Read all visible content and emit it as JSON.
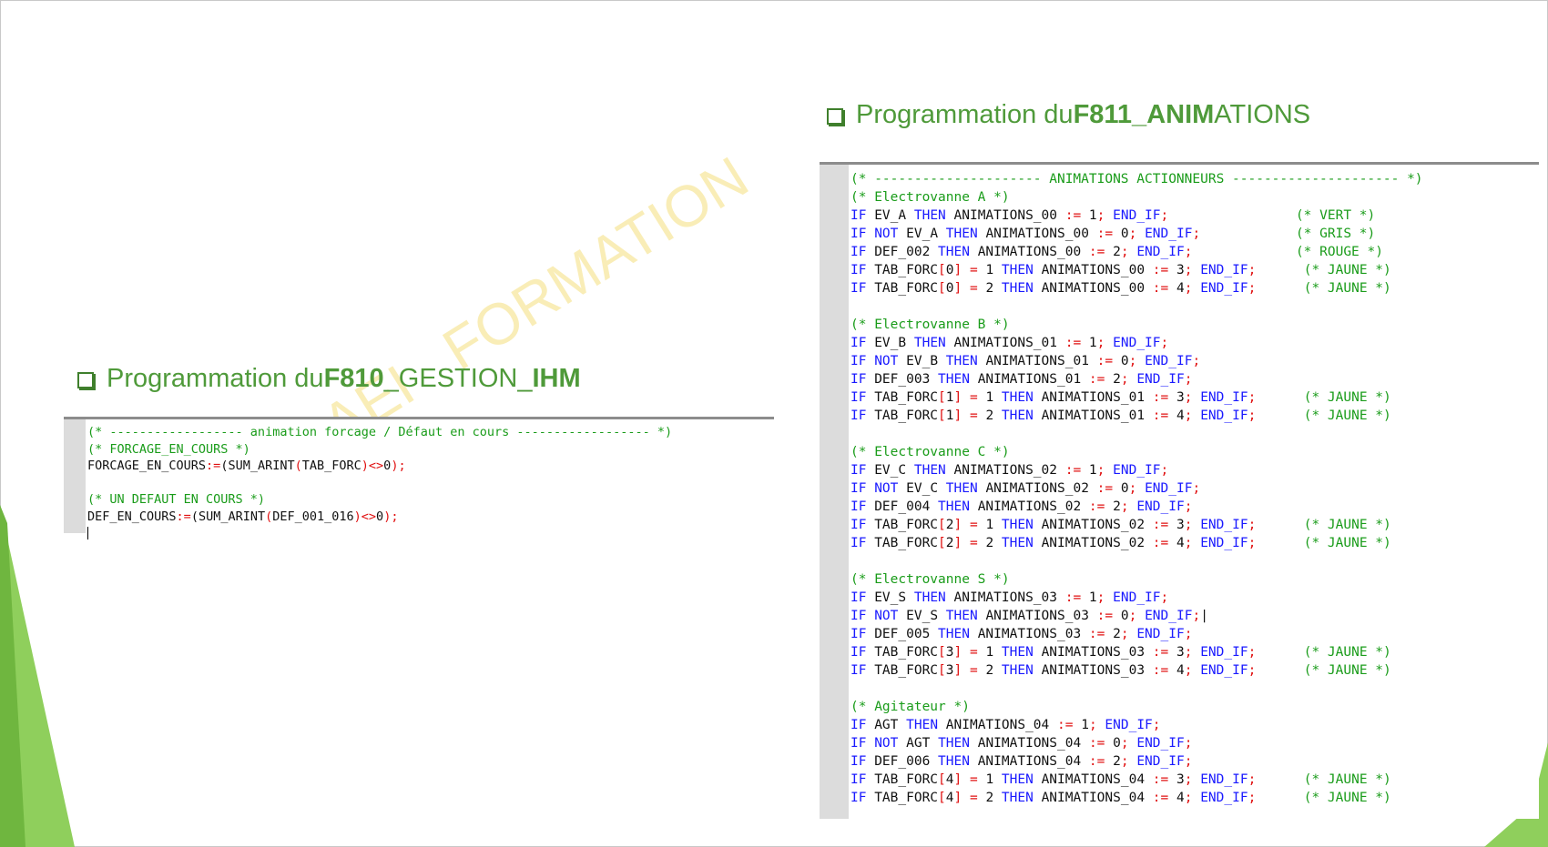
{
  "watermark": "AEI   FORMATION",
  "heading_left": {
    "prefix": "Programmation du ",
    "bold1": "F810",
    "middle": "_GESTION_",
    "bold2": "IHM",
    "suffix": ""
  },
  "heading_right": {
    "prefix": "Programmation du ",
    "bold1": "F811_ANIM",
    "middle": "ATIONS",
    "bold2": "",
    "suffix": ""
  },
  "code_left": [
    [
      {
        "t": "(* ------------------ animation forcage / Défaut en cours ------------------ *)",
        "c": "cm"
      }
    ],
    [
      {
        "t": "(* FORCAGE_EN_COURS *)",
        "c": "cm"
      }
    ],
    [
      {
        "t": "FORCAGE_EN_COURS"
      },
      {
        "t": ":=",
        "c": "op"
      },
      {
        "t": "(SUM_ARINT"
      },
      {
        "t": "(",
        "c": "op"
      },
      {
        "t": "TAB_FORC"
      },
      {
        "t": ")",
        "c": "op"
      },
      {
        "t": "<>",
        "c": "op"
      },
      {
        "t": "0"
      },
      {
        "t": ");",
        "c": "op"
      }
    ],
    [
      {
        "t": ""
      }
    ],
    [
      {
        "t": "(* UN DEFAUT EN COURS *)",
        "c": "cm"
      }
    ],
    [
      {
        "t": "DEF_EN_COURS"
      },
      {
        "t": ":=",
        "c": "op"
      },
      {
        "t": "(SUM_ARINT"
      },
      {
        "t": "(",
        "c": "op"
      },
      {
        "t": "DEF_001_016"
      },
      {
        "t": ")",
        "c": "op"
      },
      {
        "t": "<>",
        "c": "op"
      },
      {
        "t": "0"
      },
      {
        "t": ");",
        "c": "op"
      }
    ]
  ],
  "code_right": [
    [
      {
        "t": "(* --------------------- ANIMATIONS ACTIONNEURS --------------------- *)",
        "c": "cm"
      }
    ],
    [
      {
        "t": "(* Electrovanne A *)",
        "c": "cm"
      }
    ],
    [
      {
        "t": "IF",
        "c": "kw"
      },
      {
        "t": " EV_A "
      },
      {
        "t": "THEN",
        "c": "kw"
      },
      {
        "t": " ANIMATIONS_00 "
      },
      {
        "t": ":=",
        "c": "op"
      },
      {
        "t": " 1"
      },
      {
        "t": ";",
        "c": "op"
      },
      {
        "t": " "
      },
      {
        "t": "END_IF",
        "c": "kw"
      },
      {
        "t": ";",
        "c": "op"
      },
      {
        "t": "                "
      },
      {
        "t": "(* VERT *)",
        "c": "cm"
      }
    ],
    [
      {
        "t": "IF",
        "c": "kw"
      },
      {
        "t": " "
      },
      {
        "t": "NOT",
        "c": "kw"
      },
      {
        "t": " EV_A "
      },
      {
        "t": "THEN",
        "c": "kw"
      },
      {
        "t": " ANIMATIONS_00 "
      },
      {
        "t": ":=",
        "c": "op"
      },
      {
        "t": " 0"
      },
      {
        "t": ";",
        "c": "op"
      },
      {
        "t": " "
      },
      {
        "t": "END_IF",
        "c": "kw"
      },
      {
        "t": ";",
        "c": "op"
      },
      {
        "t": "            "
      },
      {
        "t": "(* GRIS *)",
        "c": "cm"
      }
    ],
    [
      {
        "t": "IF",
        "c": "kw"
      },
      {
        "t": " DEF_002 "
      },
      {
        "t": "THEN",
        "c": "kw"
      },
      {
        "t": " ANIMATIONS_00 "
      },
      {
        "t": ":=",
        "c": "op"
      },
      {
        "t": " 2"
      },
      {
        "t": ";",
        "c": "op"
      },
      {
        "t": " "
      },
      {
        "t": "END_IF",
        "c": "kw"
      },
      {
        "t": ";",
        "c": "op"
      },
      {
        "t": "             "
      },
      {
        "t": "(* ROUGE *)",
        "c": "cm"
      }
    ],
    [
      {
        "t": "IF",
        "c": "kw"
      },
      {
        "t": " TAB_FORC"
      },
      {
        "t": "[",
        "c": "op"
      },
      {
        "t": "0"
      },
      {
        "t": "]",
        "c": "op"
      },
      {
        "t": " "
      },
      {
        "t": "=",
        "c": "op"
      },
      {
        "t": " 1 "
      },
      {
        "t": "THEN",
        "c": "kw"
      },
      {
        "t": " ANIMATIONS_00 "
      },
      {
        "t": ":=",
        "c": "op"
      },
      {
        "t": " 3"
      },
      {
        "t": ";",
        "c": "op"
      },
      {
        "t": " "
      },
      {
        "t": "END_IF",
        "c": "kw"
      },
      {
        "t": ";",
        "c": "op"
      },
      {
        "t": "      "
      },
      {
        "t": "(* JAUNE *)",
        "c": "cm"
      }
    ],
    [
      {
        "t": "IF",
        "c": "kw"
      },
      {
        "t": " TAB_FORC"
      },
      {
        "t": "[",
        "c": "op"
      },
      {
        "t": "0"
      },
      {
        "t": "]",
        "c": "op"
      },
      {
        "t": " "
      },
      {
        "t": "=",
        "c": "op"
      },
      {
        "t": " 2 "
      },
      {
        "t": "THEN",
        "c": "kw"
      },
      {
        "t": " ANIMATIONS_00 "
      },
      {
        "t": ":=",
        "c": "op"
      },
      {
        "t": " 4"
      },
      {
        "t": ";",
        "c": "op"
      },
      {
        "t": " "
      },
      {
        "t": "END_IF",
        "c": "kw"
      },
      {
        "t": ";",
        "c": "op"
      },
      {
        "t": "      "
      },
      {
        "t": "(* JAUNE *)",
        "c": "cm"
      }
    ],
    [
      {
        "t": ""
      }
    ],
    [
      {
        "t": "(* Electrovanne B *)",
        "c": "cm"
      }
    ],
    [
      {
        "t": "IF",
        "c": "kw"
      },
      {
        "t": " EV_B "
      },
      {
        "t": "THEN",
        "c": "kw"
      },
      {
        "t": " ANIMATIONS_01 "
      },
      {
        "t": ":=",
        "c": "op"
      },
      {
        "t": " 1"
      },
      {
        "t": ";",
        "c": "op"
      },
      {
        "t": " "
      },
      {
        "t": "END_IF",
        "c": "kw"
      },
      {
        "t": ";",
        "c": "op"
      }
    ],
    [
      {
        "t": "IF",
        "c": "kw"
      },
      {
        "t": " "
      },
      {
        "t": "NOT",
        "c": "kw"
      },
      {
        "t": " EV_B "
      },
      {
        "t": "THEN",
        "c": "kw"
      },
      {
        "t": " ANIMATIONS_01 "
      },
      {
        "t": ":=",
        "c": "op"
      },
      {
        "t": " 0"
      },
      {
        "t": ";",
        "c": "op"
      },
      {
        "t": " "
      },
      {
        "t": "END_IF",
        "c": "kw"
      },
      {
        "t": ";",
        "c": "op"
      }
    ],
    [
      {
        "t": "IF",
        "c": "kw"
      },
      {
        "t": " DEF_003 "
      },
      {
        "t": "THEN",
        "c": "kw"
      },
      {
        "t": " ANIMATIONS_01 "
      },
      {
        "t": ":=",
        "c": "op"
      },
      {
        "t": " 2"
      },
      {
        "t": ";",
        "c": "op"
      },
      {
        "t": " "
      },
      {
        "t": "END_IF",
        "c": "kw"
      },
      {
        "t": ";",
        "c": "op"
      }
    ],
    [
      {
        "t": "IF",
        "c": "kw"
      },
      {
        "t": " TAB_FORC"
      },
      {
        "t": "[",
        "c": "op"
      },
      {
        "t": "1"
      },
      {
        "t": "]",
        "c": "op"
      },
      {
        "t": " "
      },
      {
        "t": "=",
        "c": "op"
      },
      {
        "t": " 1 "
      },
      {
        "t": "THEN",
        "c": "kw"
      },
      {
        "t": " ANIMATIONS_01 "
      },
      {
        "t": ":=",
        "c": "op"
      },
      {
        "t": " 3"
      },
      {
        "t": ";",
        "c": "op"
      },
      {
        "t": " "
      },
      {
        "t": "END_IF",
        "c": "kw"
      },
      {
        "t": ";",
        "c": "op"
      },
      {
        "t": "      "
      },
      {
        "t": "(* JAUNE *)",
        "c": "cm"
      }
    ],
    [
      {
        "t": "IF",
        "c": "kw"
      },
      {
        "t": " TAB_FORC"
      },
      {
        "t": "[",
        "c": "op"
      },
      {
        "t": "1"
      },
      {
        "t": "]",
        "c": "op"
      },
      {
        "t": " "
      },
      {
        "t": "=",
        "c": "op"
      },
      {
        "t": " 2 "
      },
      {
        "t": "THEN",
        "c": "kw"
      },
      {
        "t": " ANIMATIONS_01 "
      },
      {
        "t": ":=",
        "c": "op"
      },
      {
        "t": " 4"
      },
      {
        "t": ";",
        "c": "op"
      },
      {
        "t": " "
      },
      {
        "t": "END_IF",
        "c": "kw"
      },
      {
        "t": ";",
        "c": "op"
      },
      {
        "t": "      "
      },
      {
        "t": "(* JAUNE *)",
        "c": "cm"
      }
    ],
    [
      {
        "t": ""
      }
    ],
    [
      {
        "t": "(* Electrovanne C *)",
        "c": "cm"
      }
    ],
    [
      {
        "t": "IF",
        "c": "kw"
      },
      {
        "t": " EV_C "
      },
      {
        "t": "THEN",
        "c": "kw"
      },
      {
        "t": " ANIMATIONS_02 "
      },
      {
        "t": ":=",
        "c": "op"
      },
      {
        "t": " 1"
      },
      {
        "t": ";",
        "c": "op"
      },
      {
        "t": " "
      },
      {
        "t": "END_IF",
        "c": "kw"
      },
      {
        "t": ";",
        "c": "op"
      }
    ],
    [
      {
        "t": "IF",
        "c": "kw"
      },
      {
        "t": " "
      },
      {
        "t": "NOT",
        "c": "kw"
      },
      {
        "t": " EV_C "
      },
      {
        "t": "THEN",
        "c": "kw"
      },
      {
        "t": " ANIMATIONS_02 "
      },
      {
        "t": ":=",
        "c": "op"
      },
      {
        "t": " 0"
      },
      {
        "t": ";",
        "c": "op"
      },
      {
        "t": " "
      },
      {
        "t": "END_IF",
        "c": "kw"
      },
      {
        "t": ";",
        "c": "op"
      }
    ],
    [
      {
        "t": "IF",
        "c": "kw"
      },
      {
        "t": " DEF_004 "
      },
      {
        "t": "THEN",
        "c": "kw"
      },
      {
        "t": " ANIMATIONS_02 "
      },
      {
        "t": ":=",
        "c": "op"
      },
      {
        "t": " 2"
      },
      {
        "t": ";",
        "c": "op"
      },
      {
        "t": " "
      },
      {
        "t": "END_IF",
        "c": "kw"
      },
      {
        "t": ";",
        "c": "op"
      }
    ],
    [
      {
        "t": "IF",
        "c": "kw"
      },
      {
        "t": " TAB_FORC"
      },
      {
        "t": "[",
        "c": "op"
      },
      {
        "t": "2"
      },
      {
        "t": "]",
        "c": "op"
      },
      {
        "t": " "
      },
      {
        "t": "=",
        "c": "op"
      },
      {
        "t": " 1 "
      },
      {
        "t": "THEN",
        "c": "kw"
      },
      {
        "t": " ANIMATIONS_02 "
      },
      {
        "t": ":=",
        "c": "op"
      },
      {
        "t": " 3"
      },
      {
        "t": ";",
        "c": "op"
      },
      {
        "t": " "
      },
      {
        "t": "END_IF",
        "c": "kw"
      },
      {
        "t": ";",
        "c": "op"
      },
      {
        "t": "      "
      },
      {
        "t": "(* JAUNE *)",
        "c": "cm"
      }
    ],
    [
      {
        "t": "IF",
        "c": "kw"
      },
      {
        "t": " TAB_FORC"
      },
      {
        "t": "[",
        "c": "op"
      },
      {
        "t": "2"
      },
      {
        "t": "]",
        "c": "op"
      },
      {
        "t": " "
      },
      {
        "t": "=",
        "c": "op"
      },
      {
        "t": " 2 "
      },
      {
        "t": "THEN",
        "c": "kw"
      },
      {
        "t": " ANIMATIONS_02 "
      },
      {
        "t": ":=",
        "c": "op"
      },
      {
        "t": " 4"
      },
      {
        "t": ";",
        "c": "op"
      },
      {
        "t": " "
      },
      {
        "t": "END_IF",
        "c": "kw"
      },
      {
        "t": ";",
        "c": "op"
      },
      {
        "t": "      "
      },
      {
        "t": "(* JAUNE *)",
        "c": "cm"
      }
    ],
    [
      {
        "t": ""
      }
    ],
    [
      {
        "t": "(* Electrovanne S *)",
        "c": "cm"
      }
    ],
    [
      {
        "t": "IF",
        "c": "kw"
      },
      {
        "t": " EV_S "
      },
      {
        "t": "THEN",
        "c": "kw"
      },
      {
        "t": " ANIMATIONS_03 "
      },
      {
        "t": ":=",
        "c": "op"
      },
      {
        "t": " 1"
      },
      {
        "t": ";",
        "c": "op"
      },
      {
        "t": " "
      },
      {
        "t": "END_IF",
        "c": "kw"
      },
      {
        "t": ";",
        "c": "op"
      }
    ],
    [
      {
        "t": "IF",
        "c": "kw"
      },
      {
        "t": " "
      },
      {
        "t": "NOT",
        "c": "kw"
      },
      {
        "t": " EV_S "
      },
      {
        "t": "THEN",
        "c": "kw"
      },
      {
        "t": " ANIMATIONS_03 "
      },
      {
        "t": ":=",
        "c": "op"
      },
      {
        "t": " 0"
      },
      {
        "t": ";",
        "c": "op"
      },
      {
        "t": " "
      },
      {
        "t": "END_IF",
        "c": "kw"
      },
      {
        "t": ";",
        "c": "op"
      },
      {
        "t": "|"
      }
    ],
    [
      {
        "t": "IF",
        "c": "kw"
      },
      {
        "t": " DEF_005 "
      },
      {
        "t": "THEN",
        "c": "kw"
      },
      {
        "t": " ANIMATIONS_03 "
      },
      {
        "t": ":=",
        "c": "op"
      },
      {
        "t": " 2"
      },
      {
        "t": ";",
        "c": "op"
      },
      {
        "t": " "
      },
      {
        "t": "END_IF",
        "c": "kw"
      },
      {
        "t": ";",
        "c": "op"
      }
    ],
    [
      {
        "t": "IF",
        "c": "kw"
      },
      {
        "t": " TAB_FORC"
      },
      {
        "t": "[",
        "c": "op"
      },
      {
        "t": "3"
      },
      {
        "t": "]",
        "c": "op"
      },
      {
        "t": " "
      },
      {
        "t": "=",
        "c": "op"
      },
      {
        "t": " 1 "
      },
      {
        "t": "THEN",
        "c": "kw"
      },
      {
        "t": " ANIMATIONS_03 "
      },
      {
        "t": ":=",
        "c": "op"
      },
      {
        "t": " 3"
      },
      {
        "t": ";",
        "c": "op"
      },
      {
        "t": " "
      },
      {
        "t": "END_IF",
        "c": "kw"
      },
      {
        "t": ";",
        "c": "op"
      },
      {
        "t": "      "
      },
      {
        "t": "(* JAUNE *)",
        "c": "cm"
      }
    ],
    [
      {
        "t": "IF",
        "c": "kw"
      },
      {
        "t": " TAB_FORC"
      },
      {
        "t": "[",
        "c": "op"
      },
      {
        "t": "3"
      },
      {
        "t": "]",
        "c": "op"
      },
      {
        "t": " "
      },
      {
        "t": "=",
        "c": "op"
      },
      {
        "t": " 2 "
      },
      {
        "t": "THEN",
        "c": "kw"
      },
      {
        "t": " ANIMATIONS_03 "
      },
      {
        "t": ":=",
        "c": "op"
      },
      {
        "t": " 4"
      },
      {
        "t": ";",
        "c": "op"
      },
      {
        "t": " "
      },
      {
        "t": "END_IF",
        "c": "kw"
      },
      {
        "t": ";",
        "c": "op"
      },
      {
        "t": "      "
      },
      {
        "t": "(* JAUNE *)",
        "c": "cm"
      }
    ],
    [
      {
        "t": ""
      }
    ],
    [
      {
        "t": "(* Agitateur *)",
        "c": "cm"
      }
    ],
    [
      {
        "t": "IF",
        "c": "kw"
      },
      {
        "t": " AGT "
      },
      {
        "t": "THEN",
        "c": "kw"
      },
      {
        "t": " ANIMATIONS_04 "
      },
      {
        "t": ":=",
        "c": "op"
      },
      {
        "t": " 1"
      },
      {
        "t": ";",
        "c": "op"
      },
      {
        "t": " "
      },
      {
        "t": "END_IF",
        "c": "kw"
      },
      {
        "t": ";",
        "c": "op"
      }
    ],
    [
      {
        "t": "IF",
        "c": "kw"
      },
      {
        "t": " "
      },
      {
        "t": "NOT",
        "c": "kw"
      },
      {
        "t": " AGT "
      },
      {
        "t": "THEN",
        "c": "kw"
      },
      {
        "t": " ANIMATIONS_04 "
      },
      {
        "t": ":=",
        "c": "op"
      },
      {
        "t": " 0"
      },
      {
        "t": ";",
        "c": "op"
      },
      {
        "t": " "
      },
      {
        "t": "END_IF",
        "c": "kw"
      },
      {
        "t": ";",
        "c": "op"
      }
    ],
    [
      {
        "t": "IF",
        "c": "kw"
      },
      {
        "t": " DEF_006 "
      },
      {
        "t": "THEN",
        "c": "kw"
      },
      {
        "t": " ANIMATIONS_04 "
      },
      {
        "t": ":=",
        "c": "op"
      },
      {
        "t": " 2"
      },
      {
        "t": ";",
        "c": "op"
      },
      {
        "t": " "
      },
      {
        "t": "END_IF",
        "c": "kw"
      },
      {
        "t": ";",
        "c": "op"
      }
    ],
    [
      {
        "t": "IF",
        "c": "kw"
      },
      {
        "t": " TAB_FORC"
      },
      {
        "t": "[",
        "c": "op"
      },
      {
        "t": "4"
      },
      {
        "t": "]",
        "c": "op"
      },
      {
        "t": " "
      },
      {
        "t": "=",
        "c": "op"
      },
      {
        "t": " 1 "
      },
      {
        "t": "THEN",
        "c": "kw"
      },
      {
        "t": " ANIMATIONS_04 "
      },
      {
        "t": ":=",
        "c": "op"
      },
      {
        "t": " 3"
      },
      {
        "t": ";",
        "c": "op"
      },
      {
        "t": " "
      },
      {
        "t": "END_IF",
        "c": "kw"
      },
      {
        "t": ";",
        "c": "op"
      },
      {
        "t": "      "
      },
      {
        "t": "(* JAUNE *)",
        "c": "cm"
      }
    ],
    [
      {
        "t": "IF",
        "c": "kw"
      },
      {
        "t": " TAB_FORC"
      },
      {
        "t": "[",
        "c": "op"
      },
      {
        "t": "4"
      },
      {
        "t": "]",
        "c": "op"
      },
      {
        "t": " "
      },
      {
        "t": "=",
        "c": "op"
      },
      {
        "t": " 2 "
      },
      {
        "t": "THEN",
        "c": "kw"
      },
      {
        "t": " ANIMATIONS_04 "
      },
      {
        "t": ":=",
        "c": "op"
      },
      {
        "t": " 4"
      },
      {
        "t": ";",
        "c": "op"
      },
      {
        "t": " "
      },
      {
        "t": "END_IF",
        "c": "kw"
      },
      {
        "t": ";",
        "c": "op"
      },
      {
        "t": "      "
      },
      {
        "t": "(* JAUNE *)",
        "c": "cm"
      }
    ]
  ],
  "colors": {
    "keyword": "#1a1aff",
    "operator": "#e01010",
    "comment": "#1a9c1a",
    "heading": "#4f9a3a",
    "accent_green": "#8fcf5c"
  }
}
